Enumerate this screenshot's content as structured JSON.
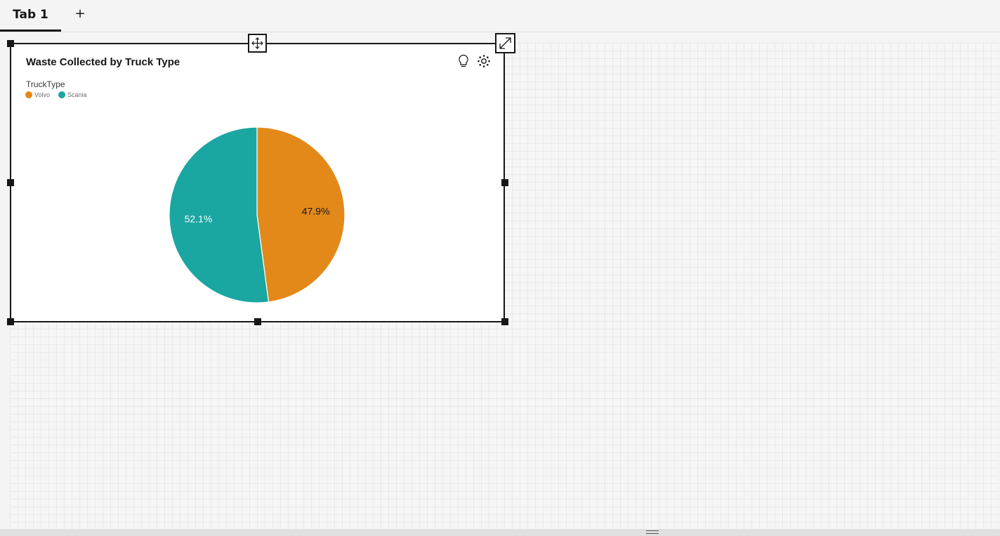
{
  "tabs": [
    {
      "label": "Tab 1",
      "active": true
    }
  ],
  "add_tab_label": "+",
  "widget": {
    "title": "Waste Collected by Truck Type",
    "legend_title": "TruckType",
    "icons": [
      "lightbulb-icon",
      "settings-dots-icon",
      "move-icon",
      "expand-icon"
    ]
  },
  "colors": {
    "volvo": "#e3891a",
    "scania": "#1aa6a1"
  },
  "chart_data": {
    "type": "pie",
    "title": "Waste Collected by Truck Type",
    "legend_title": "TruckType",
    "legend_placement": "top-left",
    "slices": [
      {
        "name": "Volvo",
        "value": 47.9,
        "label": "47.9%",
        "color": "#e3891a"
      },
      {
        "name": "Scania",
        "value": 52.1,
        "label": "52.1%",
        "color": "#1aa6a1"
      }
    ]
  }
}
